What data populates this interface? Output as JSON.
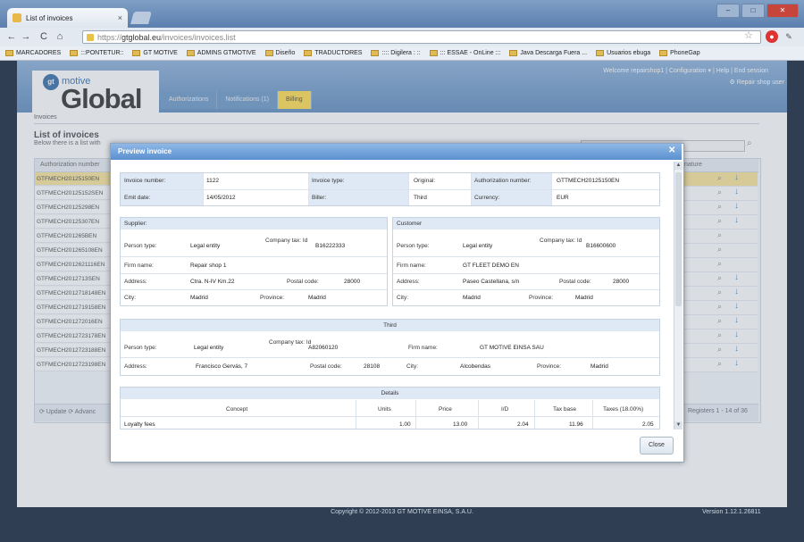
{
  "browser": {
    "tab_title": "List of invoices",
    "url_prefix": "https://",
    "url_domain": "gtglobal.eu",
    "url_path": "/invoices/invoices.list",
    "window_minimize": "–",
    "window_maximize": "□",
    "window_close": "✕",
    "bookmarks": [
      "MARCADORES",
      ":::PONTETUR::",
      "GT MOTIVE",
      "ADMINS GTMOTIVE",
      "Diseño",
      "TRADUCTORES",
      ":::: Digilera : ::",
      "::: ESSAE - OnLine :::",
      "Java Descarga Fuera ...",
      "Usuarios ebuga",
      "PhoneGap"
    ]
  },
  "header": {
    "logo_prefix": "gt",
    "logo_motive": "motive",
    "logo_text": "Global",
    "welcome": "Welcome repairshop1 | Configuration ▾ | Help | End session",
    "user_link": "Repair shop user",
    "nav_tabs": [
      "Authorizations",
      "Notifications (1)",
      "Billing"
    ]
  },
  "page": {
    "breadcrumb": "Invoices",
    "title": "List of invoices",
    "subtitle": "Below there is a list with",
    "grid_header_auth": "Authorization number",
    "grid_header_sig": "nature",
    "rows": [
      "GTFMECH20125150EN",
      "GTFMECH20125152SEN",
      "GTFMECH20125298EN",
      "GTFMECH20125307EN",
      "GTFMECH201265BEN",
      "GTFMECH201265108EN",
      "GTFMECH2012621116EN",
      "GTFMECH2012713SEN",
      "GTFMECH2012718148EN",
      "GTFMECH2012719158EN",
      "GTFMECH201272016EN",
      "GTFMECH2012723178EN",
      "GTFMECH2012723188EN",
      "GTFMECH2012723198EN"
    ],
    "footer_left": "⟳ Update  ⟳ Advanc",
    "footer_right": "Registers 1 - 14 of 36",
    "copyright": "Copyright © 2012-2013 GT MOTIVE EINSA, S.A.U.",
    "version": "Version 1.12.1.26811"
  },
  "modal": {
    "title": "Preview invoice",
    "close_label": "Close",
    "invoice": {
      "number_label": "Invoice number:",
      "number": "1122",
      "type_label": "Invoice type:",
      "type": "Original:",
      "auth_label": "Authorization number:",
      "auth": "GTTMECH20125150EN",
      "date_label": "Emit date:",
      "date": "14/05/2012",
      "biller_label": "Biller:",
      "biller": "Third",
      "currency_label": "Currency:",
      "currency": "EUR"
    },
    "supplier": {
      "heading": "Supplier:",
      "person_type_label": "Person type:",
      "person_type": "Legal entity",
      "tax_label": "Company tax: Id",
      "tax": "B16222333",
      "firm_label": "Firm name:",
      "firm": "Repair shop 1",
      "address_label": "Address:",
      "address": "Ctra. N-IV Km.22",
      "postal_label": "Postal code:",
      "postal": "28000",
      "city_label": "City:",
      "city": "Madrid",
      "province_label": "Province:",
      "province": "Madrid"
    },
    "customer": {
      "heading": "Customer",
      "person_type_label": "Person type:",
      "person_type": "Legal entity",
      "tax_label": "Company tax: Id",
      "tax": "B16600600",
      "firm_label": "Firm name:",
      "firm": "GT FLEET DEMO EN",
      "address_label": "Address:",
      "address": "Paseo Castellana, s/n",
      "postal_label": "Postal code:",
      "postal": "28000",
      "city_label": "City:",
      "city": "Madrid",
      "province_label": "Province:",
      "province": "Madrid"
    },
    "third": {
      "heading": "Third",
      "person_type_label": "Person type:",
      "person_type": "Legal entity",
      "tax_label": "Company tax: Id",
      "tax": "A82060120",
      "firm_label": "Firm name:",
      "firm": "GT MOTIVE EINSA SAU",
      "address_label": "Address:",
      "address": "Francisco Gervás, 7",
      "postal_label": "Postal code:",
      "postal": "28108",
      "city_label": "City:",
      "city": "Alcobendas",
      "province_label": "Province:",
      "province": "Madrid"
    },
    "details": {
      "heading": "Details",
      "columns": [
        "Concept",
        "Units",
        "Price",
        "I/D",
        "Tax base",
        "Taxes (18.00%)"
      ],
      "row": [
        "Loyalty fees",
        "1.00",
        "13.00",
        "2.04",
        "11.96",
        "2.05"
      ]
    }
  }
}
